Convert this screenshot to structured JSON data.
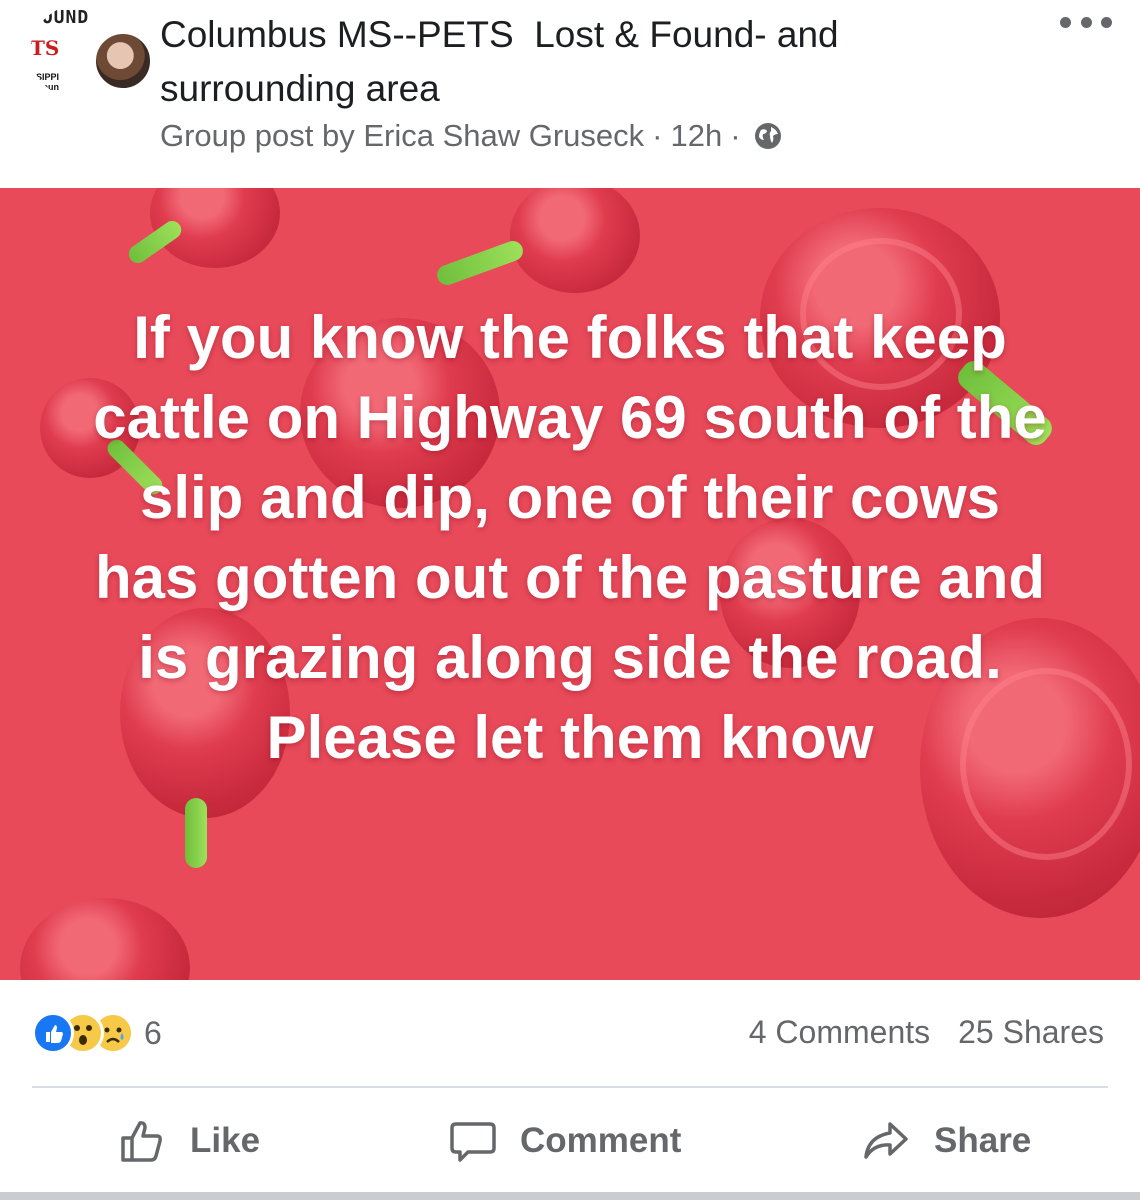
{
  "group": {
    "logo_found": "FOUND",
    "logo_ts": "TS",
    "logo_ms": "SSIPPI\nurroun",
    "title": "Columbus MS--PETS  Lost & Found- and surrounding area"
  },
  "post": {
    "meta_prefix": "Group post by Erica Shaw Gruseck",
    "time": "12h",
    "privacy_icon": "globe-icon",
    "text": "If you know the folks that keep cattle on Highway 69 south of the slip and dip, one of their cows has gotten out of the pasture and is grazing along side the road. Please let them know",
    "background_color": "#e84a5a"
  },
  "stats": {
    "reactions": [
      "like",
      "wow",
      "sad"
    ],
    "reaction_count": "6",
    "comments": "4 Comments",
    "shares": "25 Shares"
  },
  "actions": {
    "like": "Like",
    "comment": "Comment",
    "share": "Share"
  },
  "colors": {
    "text_primary": "#1c1e21",
    "text_secondary": "#65676b",
    "like_blue": "#1877f2",
    "divider": "#dadde1"
  }
}
